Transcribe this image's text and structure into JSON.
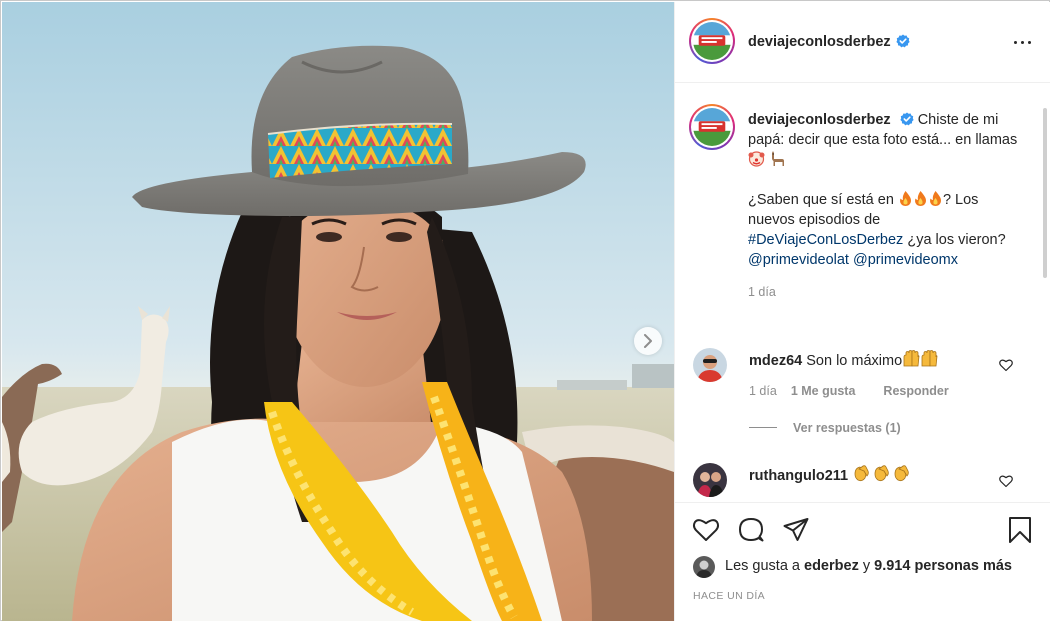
{
  "post": {
    "username": "deviajeconlosderbez",
    "verified": true
  },
  "caption": {
    "username": "deviajeconlosderbez",
    "line1": "Chiste de mi papá: decir que esta foto está... en llamas",
    "line2a": "¿Saben que sí está en",
    "line2b": "? Los nuevos episodios de",
    "hashtag": "#DeViajeConLosDerbez",
    "line2c": "¿ya los vieron?",
    "mention1": "@primevideolat",
    "mention2": "@primevideomx",
    "time": "1 día"
  },
  "comments": [
    {
      "username": "mdez64",
      "text": "Son lo máximo",
      "time": "1 día",
      "likes": "1 Me gusta",
      "reply": "Responder",
      "view_replies": "Ver respuestas (1)"
    },
    {
      "username": "ruthangulo211",
      "text": ""
    }
  ],
  "likes": {
    "prefix": "Les gusta a",
    "user": "ederbez",
    "connector": "y",
    "count": "9.914 personas más"
  },
  "timestamp": "HACE UN DÍA",
  "icons": {
    "like": "heart-icon",
    "comment": "comment-icon",
    "share": "share-icon",
    "save": "bookmark-icon",
    "next": "chevron-right-icon",
    "more": "more-icon"
  },
  "colors": {
    "verified": "#3897f0",
    "link": "#00376b",
    "muted": "#8e8e8e"
  }
}
